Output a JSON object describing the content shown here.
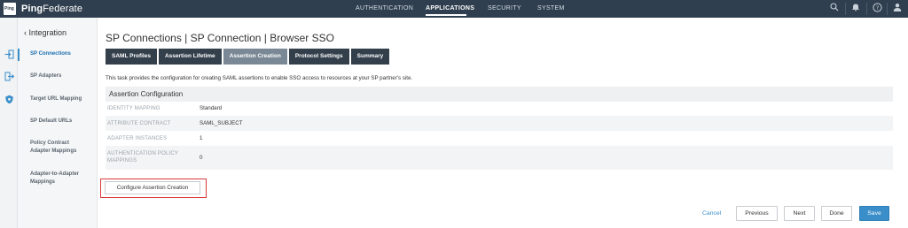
{
  "app": {
    "logo_text": "Ping",
    "brand_bold": "Ping",
    "brand_light": "Federate"
  },
  "topnav": {
    "items": [
      {
        "label": "AUTHENTICATION",
        "active": false
      },
      {
        "label": "APPLICATIONS",
        "active": true
      },
      {
        "label": "SECURITY",
        "active": false
      },
      {
        "label": "SYSTEM",
        "active": false
      }
    ],
    "icons": [
      "search-icon",
      "bell-icon",
      "help-icon",
      "user-icon"
    ]
  },
  "rail": {
    "icons": [
      "sign-in-icon",
      "sign-out-icon",
      "shield-icon"
    ]
  },
  "subnav": {
    "back_label": "Integration",
    "items": [
      {
        "label": "SP Connections",
        "active": true
      },
      {
        "label": "SP Adapters",
        "active": false
      },
      {
        "label": "Target URL Mapping",
        "active": false
      },
      {
        "label": "SP Default URLs",
        "active": false
      },
      {
        "label": "Policy Contract Adapter Mappings",
        "active": false
      },
      {
        "label": "Adapter-to-Adapter Mappings",
        "active": false
      }
    ]
  },
  "main": {
    "title": "SP Connections | SP Connection | Browser SSO",
    "tabs": [
      {
        "label": "SAML Profiles",
        "active": false
      },
      {
        "label": "Assertion Lifetime",
        "active": false
      },
      {
        "label": "Assertion Creation",
        "active": true
      },
      {
        "label": "Protocol Settings",
        "active": false
      },
      {
        "label": "Summary",
        "active": false
      }
    ],
    "description": "This task provides the configuration for creating SAML assertions to enable SSO access to resources at your SP partner's site.",
    "section_title": "Assertion Configuration",
    "rows": [
      {
        "label": "IDENTITY MAPPING",
        "value": "Standard"
      },
      {
        "label": "ATTRIBUTE CONTRACT",
        "value": "SAML_SUBJECT"
      },
      {
        "label": "ADAPTER INSTANCES",
        "value": "1"
      },
      {
        "label": "AUTHENTICATION POLICY MAPPINGS",
        "value": "0"
      }
    ],
    "configure_button": "Configure Assertion Creation"
  },
  "footer": {
    "cancel": "Cancel",
    "previous": "Previous",
    "next": "Next",
    "done": "Done",
    "save": "Save"
  },
  "colors": {
    "topbar": "#2f3f4f",
    "accent": "#3a8ec9",
    "tab": "#333f4b",
    "tab_active": "#7a8895",
    "highlight": "#d93a3a"
  }
}
